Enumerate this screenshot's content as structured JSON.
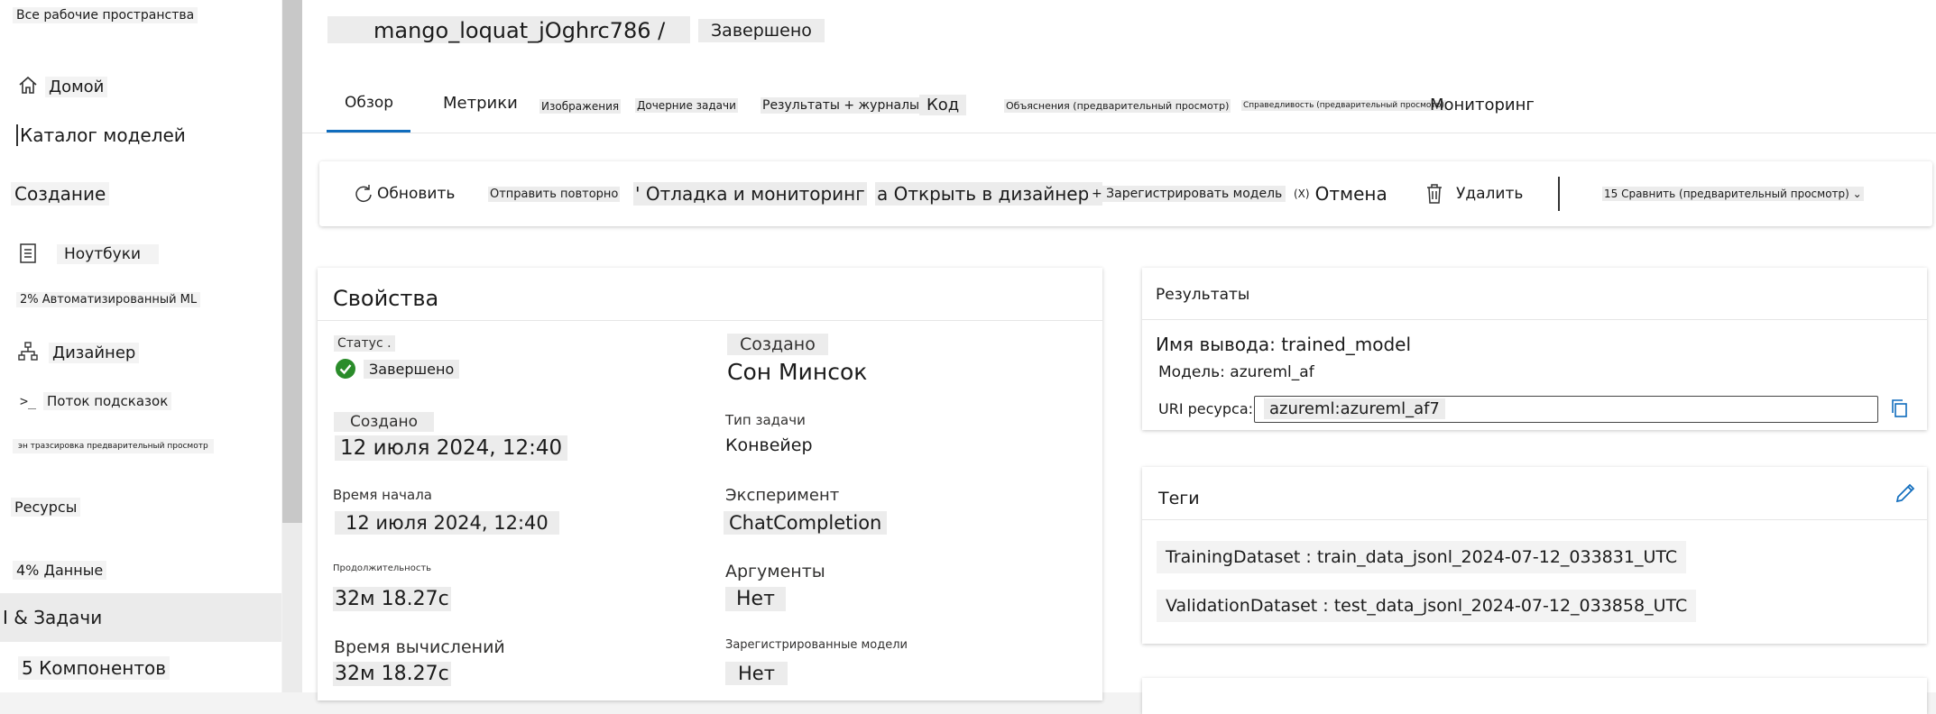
{
  "sidebar": {
    "workspaces_label": "Все рабочие пространства",
    "items": [
      {
        "label": "Домой",
        "icon": "home-icon"
      },
      {
        "label": "Каталог моделей"
      },
      {
        "label": "Создание"
      },
      {
        "label": "Ноутбуки",
        "icon": "notebook-icon"
      },
      {
        "label": "2% Автоматизированный ML"
      },
      {
        "label": "Дизайнер",
        "icon": "designer-icon"
      },
      {
        "label": "Поток подсказок",
        "icon": "prompt-flow-icon"
      },
      {
        "label": "эн тразсировка предварительный просмотр"
      },
      {
        "label": "Ресурсы"
      },
      {
        "label": "4% Данные"
      },
      {
        "label": "I & Задачи"
      },
      {
        "label": "5 Компонентов"
      }
    ]
  },
  "header": {
    "run_name": "mango_loquat_jOghrc786 /",
    "status": "Завершено"
  },
  "tabs": [
    {
      "label": "Обзор",
      "active": true
    },
    {
      "label": "Метрики"
    },
    {
      "label": "Изображения"
    },
    {
      "label": "Дочерние задачи"
    },
    {
      "label": "Результаты + журналы"
    },
    {
      "label": "Код"
    },
    {
      "label": "Объяснения (предварительный просмотр)"
    },
    {
      "label": "Справедливость (предварительный просмотр)"
    },
    {
      "label": "Мониторинг"
    }
  ],
  "toolbar": {
    "refresh": "Обновить",
    "resubmit": "Отправить повторно",
    "debug": "' Отладка и мониторинг",
    "open_designer": "а Открыть в дизайнере",
    "register_model": "+ Зарегистрировать модель",
    "cancel_icon": "(X)",
    "cancel": "Отмена",
    "delete": "Удалить",
    "compare": "15 Сравнить (предварительный просмотр) ⌄"
  },
  "properties": {
    "title": "Свойства",
    "status_label": "Статус .",
    "status_value": "Завершено",
    "created_label": "Создано",
    "created_value": "12 июля 2024, 12:40",
    "start_label": "Время начала",
    "start_value": "12 июля 2024, 12:40",
    "duration_label": "Продолжительность",
    "duration_value": "32м 18.27с",
    "compute_label": "Время вычислений",
    "compute_value": "32м 18.27с",
    "created_by_label": "Создано",
    "created_by_value": "Сон Минсок",
    "task_type_label": "Тип задачи",
    "task_type_value": "Конвейер",
    "experiment_label": "Эксперимент",
    "experiment_value": "ChatCompletion",
    "args_label": "Аргументы",
    "args_value": "Нет",
    "registered_label": "Зарегистрированные модели",
    "registered_value": "Нет"
  },
  "results": {
    "title": "Результаты",
    "output_name": "Имя вывода: trained_model",
    "model": "Модель: azureml_af",
    "uri_label": "URI ресурса:",
    "uri_value": "azureml:azureml_af7"
  },
  "tags": {
    "title": "Теги",
    "items": [
      "TrainingDataset : train_data_jsonl_2024-07-12_033831_UTC",
      "ValidationDataset : test_data_jsonl_2024-07-12_033858_UTC"
    ]
  },
  "colors": {
    "accent": "#0f6cbd",
    "success": "#2a8c2a"
  }
}
